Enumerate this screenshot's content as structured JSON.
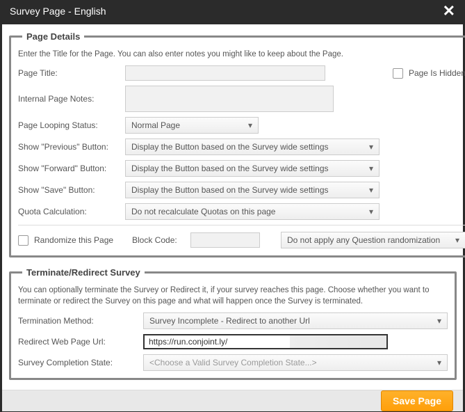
{
  "window": {
    "title": "Survey Page  -  English"
  },
  "pageDetails": {
    "legend": "Page Details",
    "desc": "Enter the Title for the Page. You can also enter notes you might like to keep about the Page.",
    "labels": {
      "pageTitle": "Page Title:",
      "internalNotes": "Internal Page Notes:",
      "looping": "Page Looping Status:",
      "prevBtn": "Show \"Previous\" Button:",
      "fwdBtn": "Show \"Forward\" Button:",
      "saveBtn": "Show \"Save\" Button:",
      "quota": "Quota Calculation:",
      "randomize": "Randomize this Page",
      "blockCode": "Block Code:",
      "pageHidden": "Page Is Hidden"
    },
    "values": {
      "pageTitle": "",
      "internalNotes": "",
      "looping": "Normal Page",
      "prevBtn": "Display the Button based on the Survey wide settings",
      "fwdBtn": "Display the Button based on the Survey wide settings",
      "saveBtn": "Display the Button based on the Survey wide settings",
      "quota": "Do not recalculate Quotas on this page",
      "blockCode": "",
      "randomDropdown": "Do not apply any Question randomization"
    }
  },
  "terminate": {
    "legend": "Terminate/Redirect Survey",
    "desc": "You can optionally terminate the Survey or Redirect it, if your survey reaches this page. Choose whether you want to terminate or redirect the Survey on this page and what will happen once the Survey is terminated.",
    "labels": {
      "method": "Termination Method:",
      "redirect": "Redirect Web Page Url:",
      "state": "Survey Completion State:"
    },
    "values": {
      "method": "Survey Incomplete - Redirect to another Url",
      "redirect": "https://run.conjoint.ly/",
      "statePlaceholder": "<Choose a Valid Survey Completion State...>"
    }
  },
  "footer": {
    "save": "Save Page"
  }
}
